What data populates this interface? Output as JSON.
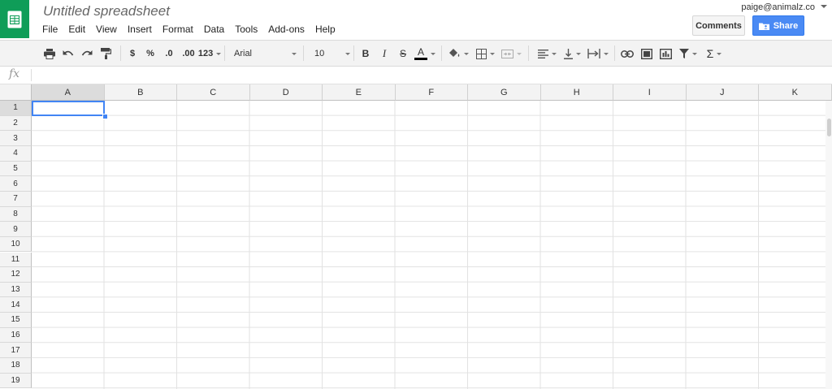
{
  "app": {
    "title": "Untitled spreadsheet",
    "user_email": "paige@animalz.co",
    "colors": {
      "brand": "#0f9d58",
      "share": "#4a8af4",
      "selection": "#4285f4"
    }
  },
  "menu": [
    "File",
    "Edit",
    "View",
    "Insert",
    "Format",
    "Data",
    "Tools",
    "Add-ons",
    "Help"
  ],
  "buttons": {
    "comments": "Comments",
    "share": "Share"
  },
  "toolbar": {
    "currency": "$",
    "percent": "%",
    "decimal_decrease": ".0",
    "decimal_increase": ".00",
    "more_formats": "123",
    "font": "Arial",
    "font_size": "10",
    "bold": "B",
    "italic": "I",
    "strikethrough": "S",
    "text_color": "A",
    "functions": "Σ",
    "icons": [
      "print-icon",
      "undo-icon",
      "redo-icon",
      "paint-format-icon",
      "fill-color-icon",
      "borders-icon",
      "merge-cells-icon",
      "align-left-icon",
      "valign-bottom-icon",
      "text-wrap-icon",
      "link-icon",
      "comment-icon",
      "chart-icon",
      "filter-icon"
    ]
  },
  "formula": {
    "fx_label": "fx",
    "value": ""
  },
  "grid": {
    "columns": [
      "A",
      "B",
      "C",
      "D",
      "E",
      "F",
      "G",
      "H",
      "I",
      "J",
      "K"
    ],
    "rows": [
      "1",
      "2",
      "3",
      "4",
      "5",
      "6",
      "7",
      "8",
      "9",
      "10",
      "11",
      "12",
      "13",
      "14",
      "15",
      "16",
      "17",
      "18",
      "19"
    ],
    "selected_cell": "A1"
  }
}
